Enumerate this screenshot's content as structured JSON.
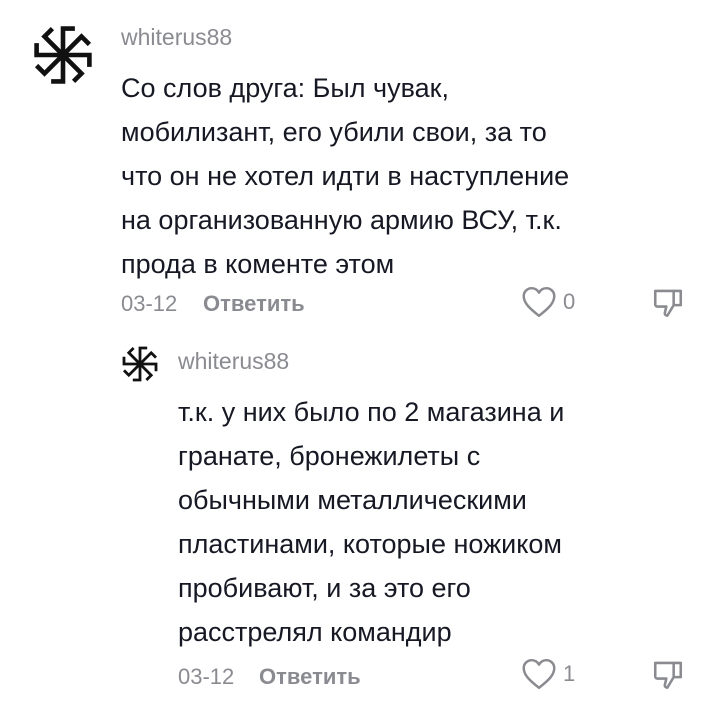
{
  "comments": [
    {
      "username": "whiterus88",
      "lines": [
        "Со слов друга: Был чувак,",
        "мобилизант, его убили свои, за то",
        "что он не хотел идти в наступление",
        "на организованную армию ВСУ, т.к.",
        "прода в коменте этом"
      ],
      "date": "03-12",
      "reply_label": "Ответить",
      "likes": "0"
    },
    {
      "username": "whiterus88",
      "lines": [
        "т.к. у них было по 2 магазина и",
        "гранате, бронежилеты с",
        "обычными металлическими",
        "пластинами, которые ножиком",
        "пробивают, и за это его",
        "расстрелял командир"
      ],
      "date": "03-12",
      "reply_label": "Ответить",
      "likes": "1"
    }
  ],
  "icons": {
    "avatar": "kolovrat-symbol-icon",
    "like": "heart-outline-icon",
    "dislike": "thumbs-down-icon"
  }
}
